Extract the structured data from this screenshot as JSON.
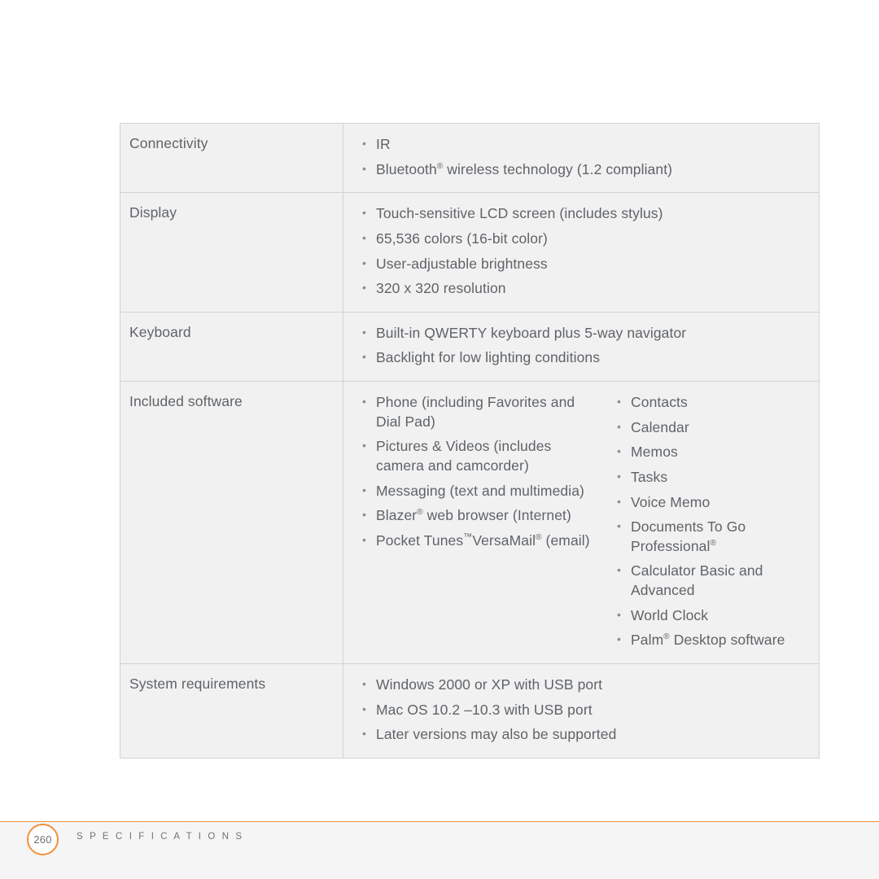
{
  "document": {
    "footer": {
      "page_number": "260",
      "section_title": "S P E C I F I C A T I O N S"
    },
    "accent_color": "#f0923a",
    "table_bg_color": "#f1f1f1",
    "text_color": "#5f6368"
  },
  "spec_table": {
    "rows": [
      {
        "label": "Connectivity",
        "columns": [
          [
            "IR",
            "Bluetooth® wireless technology (1.2 compliant)"
          ]
        ]
      },
      {
        "label": "Display",
        "columns": [
          [
            "Touch-sensitive LCD screen (includes stylus)",
            "65,536 colors (16-bit color)",
            "User-adjustable brightness",
            "320 x 320 resolution"
          ]
        ]
      },
      {
        "label": "Keyboard",
        "columns": [
          [
            "Built-in QWERTY keyboard plus 5-way navigator",
            "Backlight for low lighting conditions"
          ]
        ]
      },
      {
        "label": "Included software",
        "columns": [
          [
            "Phone (including Favorites and Dial Pad)",
            "Pictures & Videos (includes camera and camcorder)",
            "Messaging (text and multimedia)",
            "Blazer® web browser (Internet)",
            "Pocket Tunes™VersaMail® (email)"
          ],
          [
            "Contacts",
            "Calendar",
            "Memos",
            "Tasks",
            "Voice Memo",
            "Documents To Go Professional®",
            "Calculator Basic and Advanced",
            "World Clock",
            "Palm® Desktop software"
          ]
        ]
      },
      {
        "label": "System requirements",
        "columns": [
          [
            "Windows 2000 or XP with USB port",
            "Mac OS 10.2 –10.3 with USB port",
            "Later versions may also be supported"
          ]
        ]
      }
    ]
  }
}
